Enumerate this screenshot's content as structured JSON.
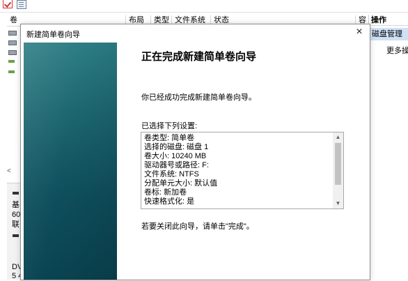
{
  "volume_table": {
    "columns": [
      "卷",
      "布局",
      "类型",
      "文件系统",
      "状态",
      "容"
    ]
  },
  "disk_pane": {
    "labels": [
      "基",
      "60",
      "联",
      "DV",
      "5 4"
    ]
  },
  "actions": {
    "title": "操作",
    "section": "磁盘管理",
    "more": "更多操"
  },
  "dialog": {
    "title": "新建简单卷向导",
    "close_label": "×",
    "heading": "正在完成新建简单卷向导",
    "message": "你已经成功完成新建简单卷向导。",
    "settings_label": "已选择下列设置:",
    "settings": [
      "卷类型: 简单卷",
      "选择的磁盘: 磁盘 1",
      "卷大小: 10240 MB",
      "驱动器号或路径: F:",
      "文件系统: NTFS",
      "分配单元大小: 默认值",
      "卷标: 新加卷",
      "快速格式化: 是"
    ],
    "close_hint": "若要关闭此向导，请单击\"完成\"。",
    "scroll_up": "▲",
    "scroll_down": "▼"
  },
  "scroll_left": "<"
}
